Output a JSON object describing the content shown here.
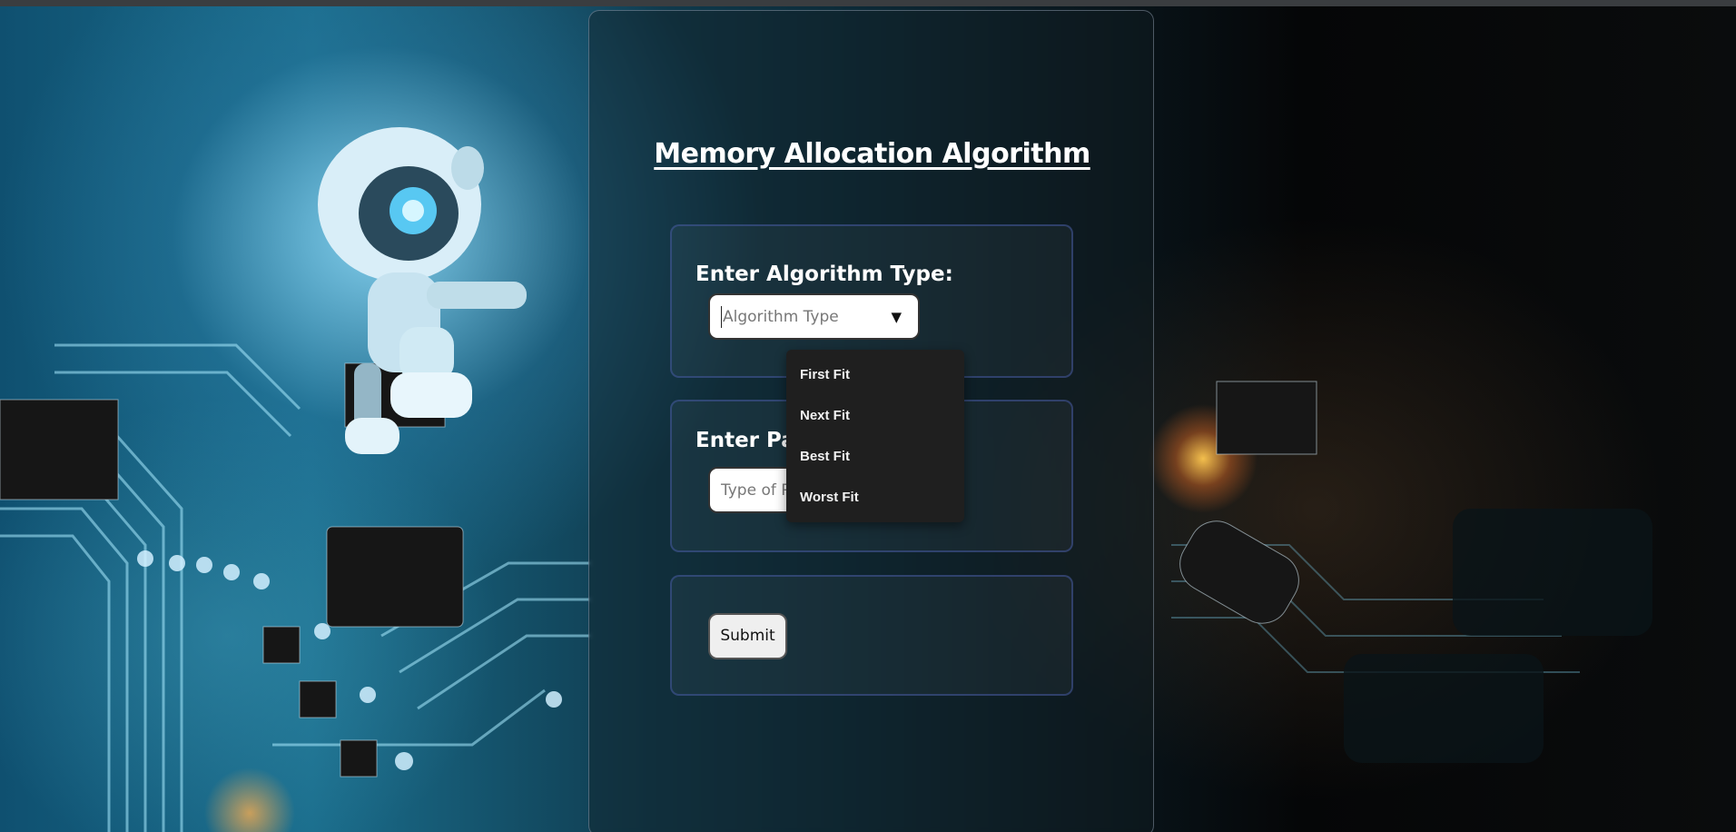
{
  "page": {
    "title": "Memory Allocation Algorithm"
  },
  "algorithm_section": {
    "label": "Enter Algorithm Type:",
    "select_placeholder": "Algorithm Type",
    "arrow_icon": "triangle-down-icon"
  },
  "partition_section": {
    "label": "Enter Pa",
    "input_placeholder": "Type of P"
  },
  "submit": {
    "label": "Submit"
  },
  "dropdown": {
    "options": [
      "First Fit",
      "Next Fit",
      "Best Fit",
      "Worst Fit"
    ]
  },
  "colors": {
    "card_border": "#a0aabe",
    "section_border": "#465aa0",
    "dropdown_bg": "#1f1f1f",
    "text": "#ffffff"
  }
}
